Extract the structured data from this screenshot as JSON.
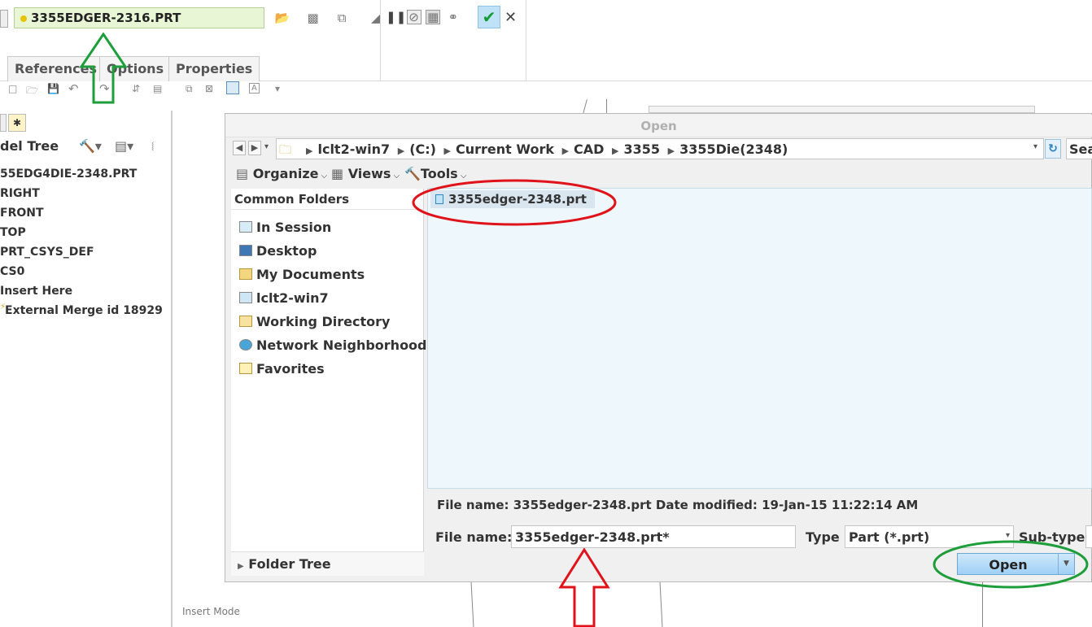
{
  "ribbon": {
    "feature_name": "3355EDGER-2316.PRT",
    "tabs": [
      "References",
      "Options",
      "Properties"
    ]
  },
  "model_tree": {
    "title": "del Tree",
    "items": [
      "55EDG4DIE-2348.PRT",
      "RIGHT",
      "FRONT",
      "TOP",
      "PRT_CSYS_DEF",
      "CS0",
      "Insert Here",
      "External Merge id 18929"
    ]
  },
  "dialog": {
    "title": "Open",
    "path": [
      "lclt2-win7",
      "(C:)",
      "Current Work",
      "CAD",
      "3355",
      "3355Die(2348)"
    ],
    "search_placeholder": "Search",
    "toolbar": [
      "Organize",
      "Views",
      "Tools"
    ],
    "common_folders_title": "Common Folders",
    "common_folders": [
      "In Session",
      "Desktop",
      "My Documents",
      "lclt2-win7",
      "Working Directory",
      "Network Neighborhood",
      "Favorites"
    ],
    "files": [
      "3355edger-2348.prt"
    ],
    "info_text": "File name: 3355edger-2348.prt  Date modified: 19-Jan-15 11:22:14 AM",
    "file_name_label": "File name:",
    "file_name_value": "3355edger-2348.prt*",
    "type_label": "Type",
    "type_value": "Part (*.prt)",
    "subtype_label": "Sub-type",
    "open_label": "Open",
    "folder_tree_label": "Folder Tree"
  },
  "status_bar": {
    "mode": "Insert Mode"
  },
  "annotation_colors": {
    "green": "#1e9e3a",
    "red": "#e0121a"
  }
}
